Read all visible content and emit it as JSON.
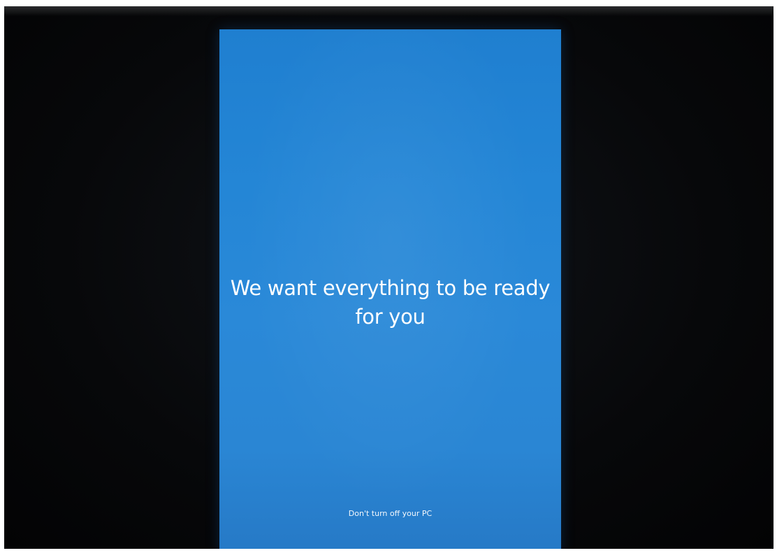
{
  "setup_screen": {
    "headline_line1": "We want everything to be ready",
    "headline_line2": "for you",
    "subtext": "Don't turn off your PC"
  },
  "colors": {
    "screen_blue": "#2a89d8",
    "text": "#ffffff",
    "bezel": "#07080a"
  }
}
